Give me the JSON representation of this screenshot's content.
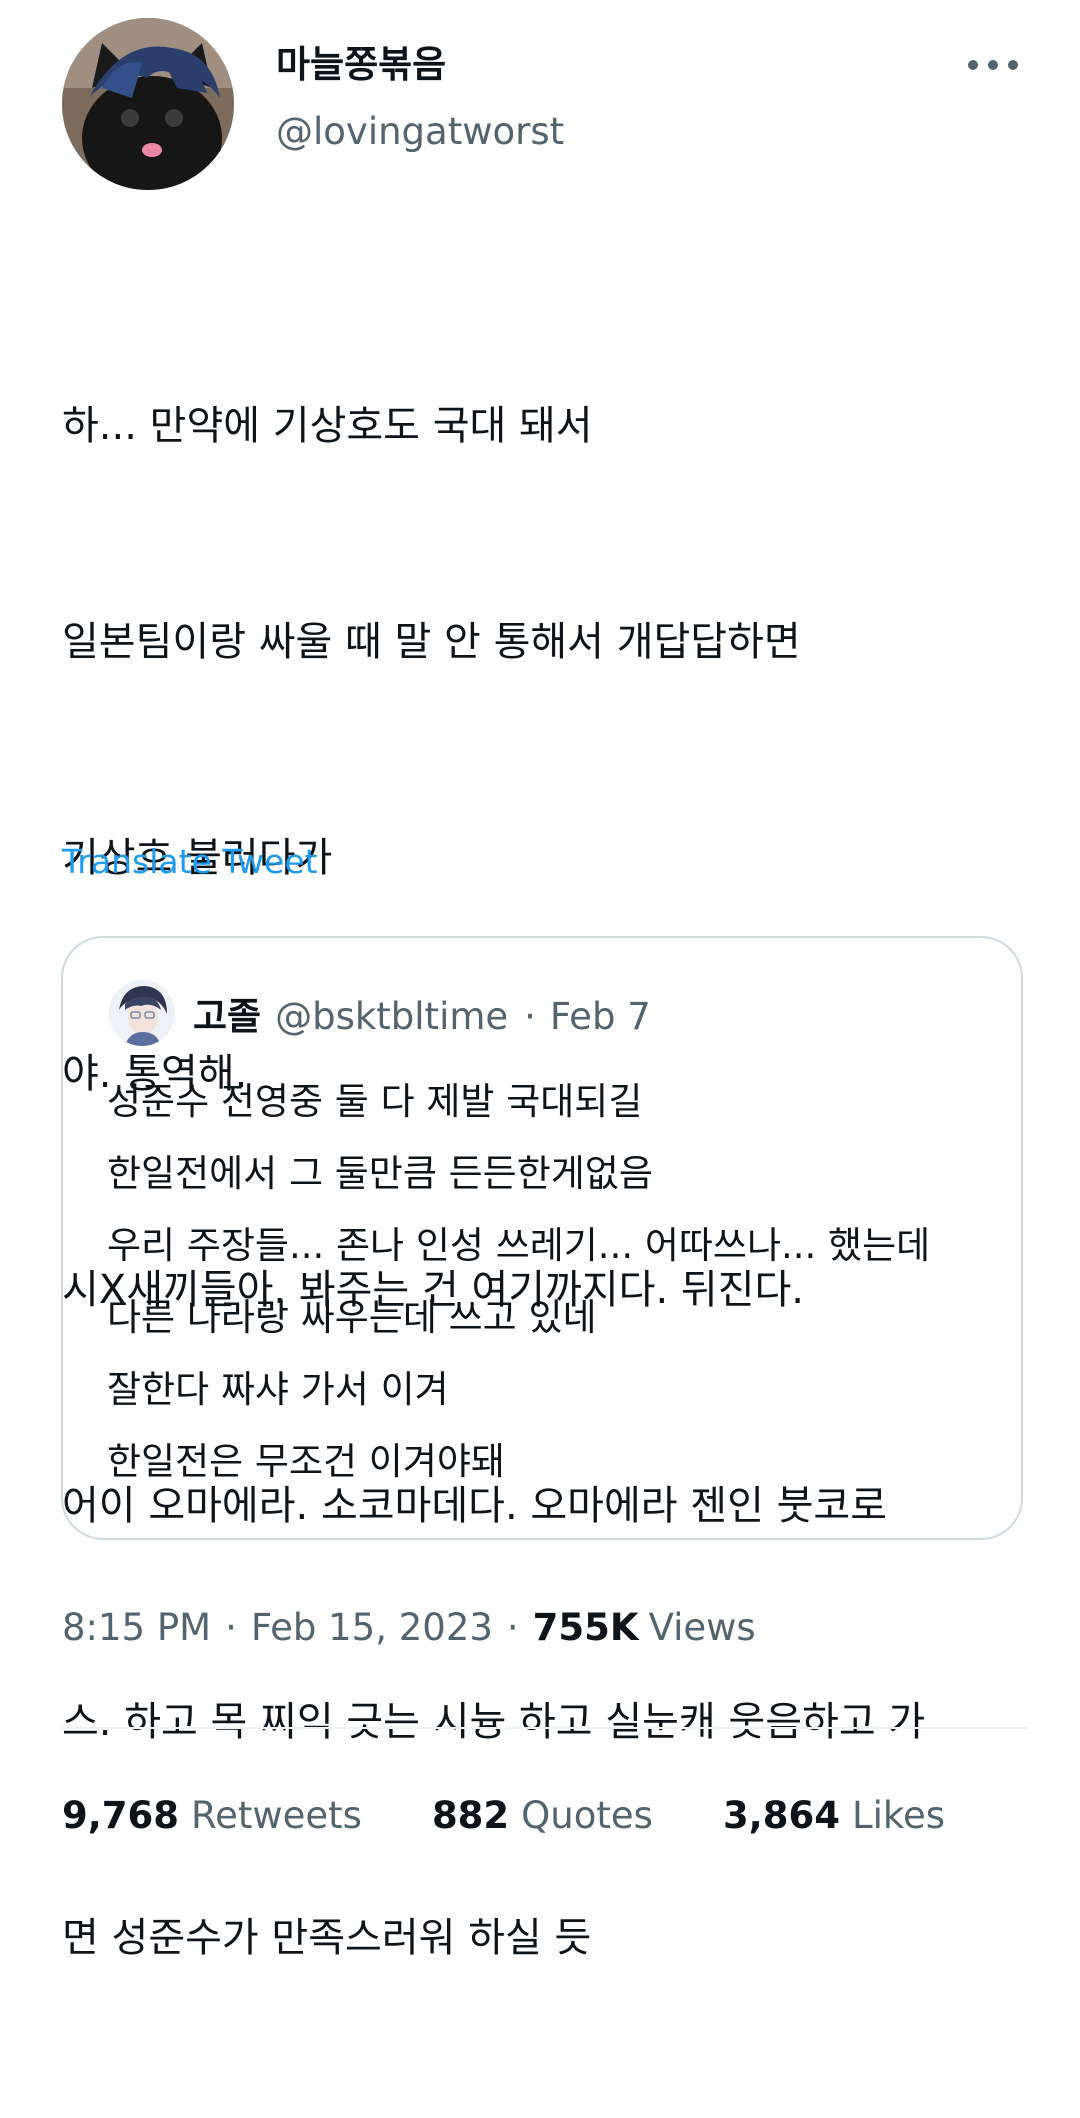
{
  "author": {
    "display_name": "마늘쫑볶음",
    "handle": "@lovingatworst"
  },
  "tweet": {
    "lines": [
      "하... 만약에 기상호도 국대 돼서",
      "일본팀이랑 싸울 때 말 안 통해서 개답답하면",
      "기상호 불러다가",
      "야. 통역해.",
      "시X새끼들아. 봐주는 건 여기까지다. 뒤진다.",
      "어이 오마에라. 소코마데다. 오마에라 젠인 붓코로",
      "스. 하고 목 찌익 긋는 시늉 하고 실눈캐 웃음하고 가",
      "면 성준수가 만족스러워 하실 듯"
    ],
    "translate_label": "Translate Tweet"
  },
  "quote": {
    "name": "고졸",
    "handle": "@bsktbltime",
    "separator": "·",
    "date": "Feb 7",
    "lines": [
      "성준수 전영중 둘 다 제발 국대되길",
      "한일전에서 그 둘만큼 든든한게없음",
      "우리 주장들... 존나 인성 쓰레기... 어따쓰나... 했는데",
      "다른 나라랑 싸우는데 쓰고 있네",
      "잘한다 짜샤 가서 이겨",
      "한일전은 무조건 이겨야돼"
    ]
  },
  "meta": {
    "time": "8:15 PM",
    "separator": "·",
    "date": "Feb 15, 2023",
    "views_count": "755K",
    "views_label": "Views"
  },
  "stats": {
    "retweets_count": "9,768",
    "retweets_label": "Retweets",
    "quotes_count": "882",
    "quotes_label": "Quotes",
    "likes_count": "3,864",
    "likes_label": "Likes"
  },
  "icons": {
    "more": "more-horizontal-icon"
  },
  "colors": {
    "link": "#1d9bf0",
    "secondary_text": "#536471",
    "border": "#cfd9de"
  }
}
